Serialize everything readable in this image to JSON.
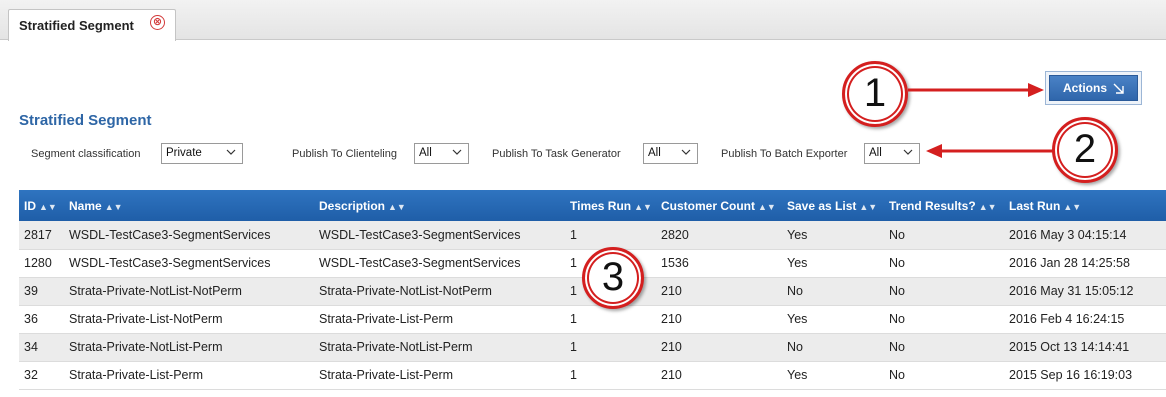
{
  "tab": {
    "label": "Stratified Segment",
    "close_symbol": "⊗"
  },
  "actions": {
    "label": "Actions"
  },
  "section_title": "Stratified Segment",
  "filters": [
    {
      "label": "Segment classification",
      "value": "Private"
    },
    {
      "label": "Publish To Clienteling",
      "value": "All"
    },
    {
      "label": "Publish To Task Generator",
      "value": "All"
    },
    {
      "label": "Publish To Batch Exporter",
      "value": "All"
    }
  ],
  "table": {
    "columns": [
      "ID",
      "Name",
      "Description",
      "Times Run",
      "Customer Count",
      "Save as List",
      "Trend Results?",
      "Last Run"
    ],
    "rows": [
      [
        "2817",
        "WSDL-TestCase3-SegmentServices",
        "WSDL-TestCase3-SegmentServices",
        "1",
        "2820",
        "Yes",
        "No",
        "2016 May 3 04:15:14"
      ],
      [
        "1280",
        "WSDL-TestCase3-SegmentServices",
        "WSDL-TestCase3-SegmentServices",
        "1",
        "1536",
        "Yes",
        "No",
        "2016 Jan 28 14:25:58"
      ],
      [
        "39",
        "Strata-Private-NotList-NotPerm",
        "Strata-Private-NotList-NotPerm",
        "1",
        "210",
        "No",
        "No",
        "2016 May 31 15:05:12"
      ],
      [
        "36",
        "Strata-Private-List-NotPerm",
        "Strata-Private-List-Perm",
        "1",
        "210",
        "Yes",
        "No",
        "2016 Feb 4 16:24:15"
      ],
      [
        "34",
        "Strata-Private-NotList-Perm",
        "Strata-Private-NotList-Perm",
        "1",
        "210",
        "No",
        "No",
        "2015 Oct 13 14:14:41"
      ],
      [
        "32",
        "Strata-Private-List-Perm",
        "Strata-Private-List-Perm",
        "1",
        "210",
        "Yes",
        "No",
        "2015 Sep 16 16:19:03"
      ]
    ]
  },
  "annotations": [
    {
      "number": "1"
    },
    {
      "number": "2"
    },
    {
      "number": "3"
    }
  ],
  "colors": {
    "accent": "#2e66a6",
    "header_bg": "#2569b4",
    "annotation": "#d41f1f"
  }
}
